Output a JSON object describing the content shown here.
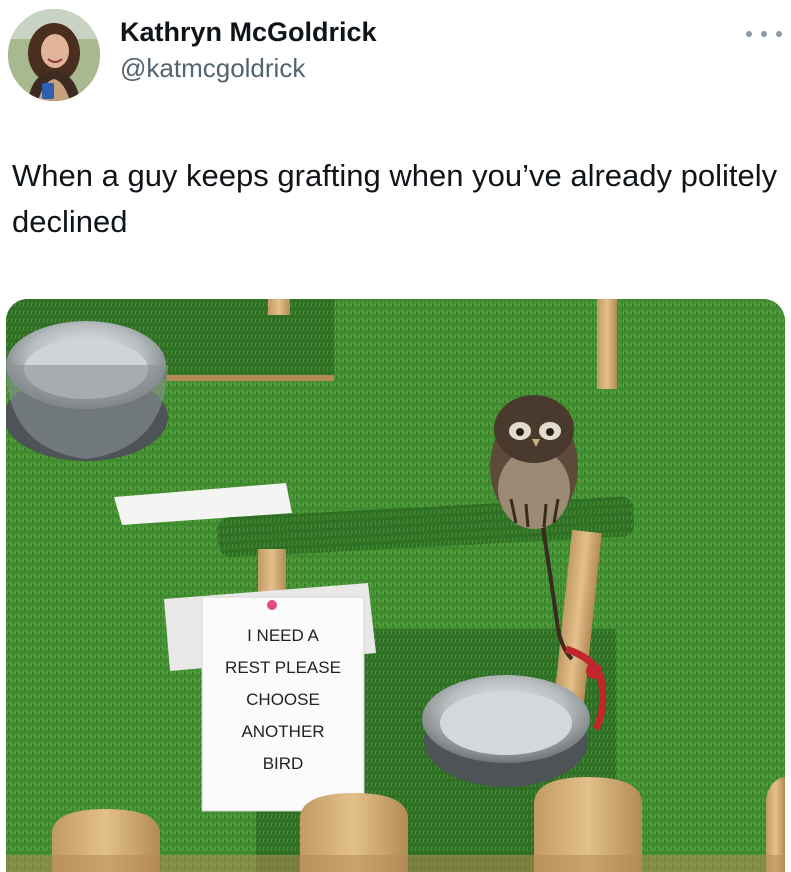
{
  "tweet": {
    "author": {
      "display_name": "Kathryn McGoldrick",
      "handle": "@katmcgoldrick"
    },
    "text": "When a guy keeps grafting when you’ve already politely declined",
    "media": {
      "sign_lines": [
        "I NEED A",
        "REST PLEASE",
        "CHOOSE",
        "ANOTHER",
        "BIRD"
      ]
    }
  },
  "icons": {
    "more": "more-options-icon"
  }
}
